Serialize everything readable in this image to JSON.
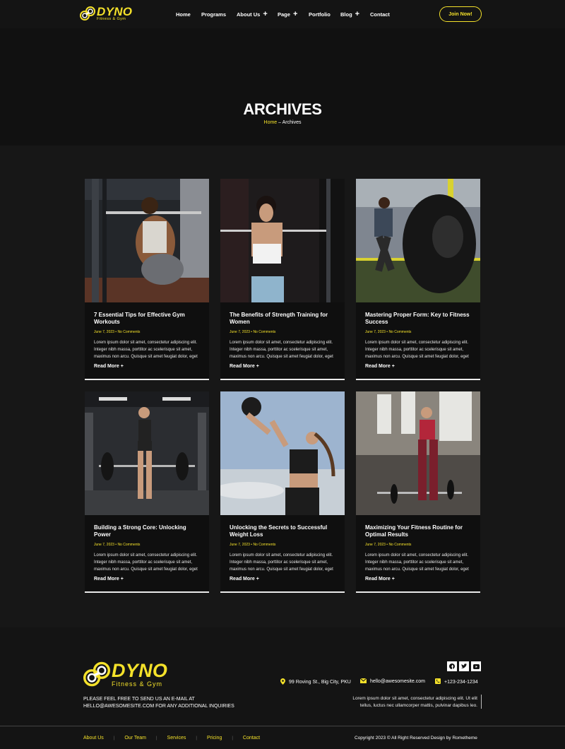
{
  "brand": {
    "name": "DYNO",
    "tagline": "Fitness & Gym"
  },
  "nav": {
    "items": [
      {
        "label": "Home",
        "dropdown": false
      },
      {
        "label": "Programs",
        "dropdown": false
      },
      {
        "label": "About Us",
        "dropdown": true
      },
      {
        "label": "Page",
        "dropdown": true
      },
      {
        "label": "Portfolio",
        "dropdown": false
      },
      {
        "label": "Blog",
        "dropdown": true
      },
      {
        "label": "Contact",
        "dropdown": false
      }
    ],
    "cta": "Join Now!"
  },
  "hero": {
    "title": "ARCHIVES",
    "breadcrumb_home": "Home",
    "breadcrumb_sep": " – ",
    "breadcrumb_current": "Archives"
  },
  "posts": [
    {
      "title": "7 Essential Tips for Effective Gym Workouts",
      "meta": "June 7, 2023 • No Comments",
      "excerpt": "Lorem ipsum dolor sit amet, consectetur adipiscing elit. Integer nibh massa, porttitor ac scelerisque sit amet, maximus non arcu. Quisque sit amet feugiat dolor, eget",
      "link": "Read More +"
    },
    {
      "title": "The Benefits of Strength Training for Women",
      "meta": "June 7, 2023 • No Comments",
      "excerpt": "Lorem ipsum dolor sit amet, consectetur adipiscing elit. Integer nibh massa, porttitor ac scelerisque sit amet, maximus non arcu. Quisque sit amet feugiat dolor, eget",
      "link": "Read More +"
    },
    {
      "title": "Mastering Proper Form: Key to Fitness Success",
      "meta": "June 7, 2023 • No Comments",
      "excerpt": "Lorem ipsum dolor sit amet, consectetur adipiscing elit. Integer nibh massa, porttitor ac scelerisque sit amet, maximus non arcu. Quisque sit amet feugiat dolor, eget",
      "link": "Read More +"
    },
    {
      "title": "Building a Strong Core: Unlocking Power",
      "meta": "June 7, 2023 • No Comments",
      "excerpt": "Lorem ipsum dolor sit amet, consectetur adipiscing elit. Integer nibh massa, porttitor ac scelerisque sit amet, maximus non arcu. Quisque sit amet feugiat dolor, eget",
      "link": "Read More +"
    },
    {
      "title": "Unlocking the Secrets to Successful Weight Loss",
      "meta": "June 7, 2023 • No Comments",
      "excerpt": "Lorem ipsum dolor sit amet, consectetur adipiscing elit. Integer nibh massa, porttitor ac scelerisque sit amet, maximus non arcu. Quisque sit amet feugiat dolor, eget",
      "link": "Read More +"
    },
    {
      "title": "Maximizing Your Fitness Routine for Optimal Results",
      "meta": "June 7, 2023 • No Comments",
      "excerpt": "Lorem ipsum dolor sit amet, consectetur adipiscing elit. Integer nibh massa, porttitor ac scelerisque sit amet, maximus non arcu. Quisque sit amet feugiat dolor, eget",
      "link": "Read More +"
    }
  ],
  "footer": {
    "mail_line1": "PLEASE FEEL FREE TO SEND US AN E-MAIL AT",
    "mail_line2": "HELLO@AWESOMESITE.COM FOR ANY ADDITIONAL INQUIRIES",
    "socials": [
      "facebook-icon",
      "twitter-icon",
      "youtube-icon"
    ],
    "address": "99 Roving St., Big City, PKU",
    "email": "hello@awesomesite.com",
    "phone": "+123-234-1234",
    "desc_line1": "Lorem ipsum dolor sit amet, consectetur adipiscing elit. Ut elit",
    "desc_line2": "tellus, luctus nec ullamcorper mattis, pulvinar dapibus leo.",
    "links": [
      "About Us",
      "Our Team",
      "Services",
      "Pricing",
      "Contact"
    ],
    "copyright": "Copyright 2023 © All Right Reserved Design by Rometheme"
  },
  "colors": {
    "accent": "#f4e12a",
    "background": "#171717",
    "card": "#0f0f0f"
  }
}
